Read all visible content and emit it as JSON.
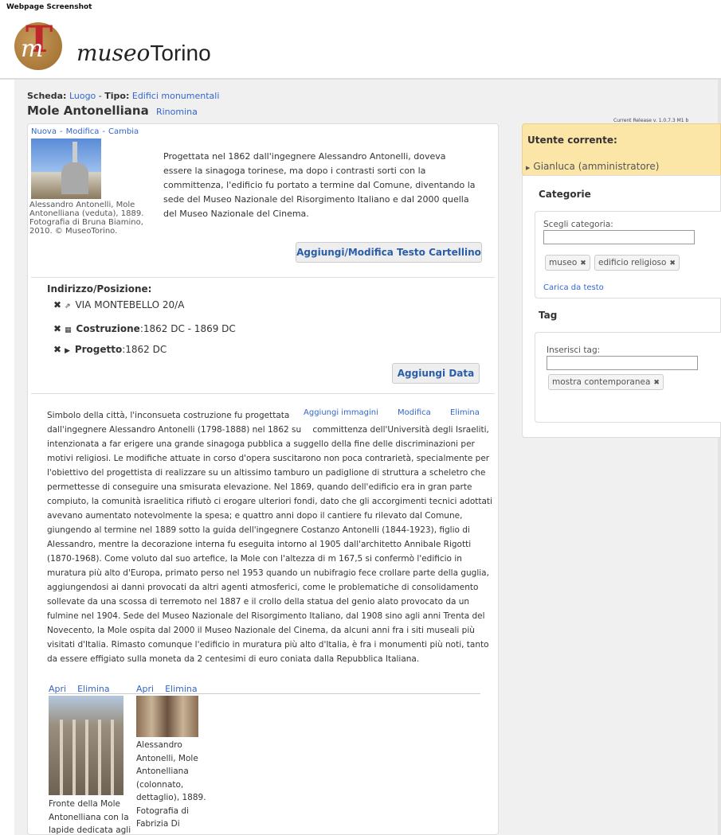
{
  "screenshot_label": "Webpage Screenshot",
  "header": {
    "logo_italic": "museo",
    "logo_upright": "Torino"
  },
  "breadcrumb": {
    "scheda_label": "Scheda:",
    "scheda_value": "Luogo",
    "tipo_label": "Tipo:",
    "tipo_value": "Edifici monumentali"
  },
  "title": {
    "name": "Mole Antonelliana",
    "rename_label": "Rinomina"
  },
  "release": "Current Release v. 1.0.7.3 M1 b",
  "card_links": {
    "nuova": "Nuova",
    "modifica": "Modifica",
    "cambia": "Cambia"
  },
  "main_image_caption": "Alessandro Antonelli, Mole Antonelliana (veduta), 1889. Fotografia di Bruna Biamino, 2010. © MuseoTorino.",
  "intro_text": "Progettata nel 1862 dall'ingegnere Alessandro Antonelli, doveva essere la sinagoga torinese, ma dopo i contrasti sorti con la committenza, l'edificio fu portato a termine dal Comune, diventando la sede del Museo Nazionale del Risorgimento Italiano e dal 2000 quella del Museo Nazionale del Cinema.",
  "buttons": {
    "cartellino": "Aggiungi/Modifica Testo Cartellino",
    "add_date": "Aggiungi Data"
  },
  "address": {
    "title": "Indirizzo/Posizione:",
    "street": "VIA MONTEBELLO 20/A",
    "costruzione_label": "Costruzione",
    "costruzione_value": ":1862 DC - 1869 DC",
    "progetto_label": "Progetto",
    "progetto_value": ":1862 DC"
  },
  "desc_actions": {
    "add_images": "Aggiungi immagini",
    "modifica": "Modifica",
    "elimina": "Elimina"
  },
  "description": {
    "lead": "Simbolo della città, l'inconsueta costruzione fu progettata dall'ingegnere Alessandro Antonelli (1798-1888) nel 1862 su",
    "body": "committenza dell'Università degli Israeliti, intenzionata a far erigere una grande sinagoga pubblica a suggello della fine delle discriminazioni per motivi religiosi. Le modifiche attuate in corso d'opera suscitarono non poca contrarietà, specialmente per l'obiettivo del progettista di realizzare su un altissimo tamburo un padiglione di struttura a scheletro che permettesse di conseguire una smisurata elevazione. Nel 1869, quando dell'edificio era in gran parte compiuto, la comunità israelitica rifiutò ci erogare ulteriori fondi, dato che gli accorgimenti tecnici adottati avevano aumentato notevolmente la spesa; e quattro anni dopo il cantiere fu rilevato dal Comune, giungendo al termine nel 1889 sotto la guida dell'ingegnere Costanzo Antonelli (1844-1923), figlio di Alessandro, mentre la decorazione interna fu eseguita intorno al 1905 dall'architetto Annibale Rigotti (1870-1968). Come voluto dal suo artefice, la Mole con l'altezza di m 167,5 si confermò l'edificio in muratura più alto d'Europa, primato perso nel 1953 quando un nubifragio fece crollare parte della guglia, aggiungendosi ai danni provocati da altri agenti atmosferici, come le problematiche di consolidamento sollevate da una scossa di terremoto nel 1887 e il crollo della statua del genio alato provocato da un fulmine nel 1904. Sede del Museo Nazionale del Risorgimento Italiano, dal 1908 sino agli anni Trenta del Novecento, la Mole ospita dal 2000 il Museo Nazionale del Cinema, da alcuni anni fra i siti museali più visitati d'Italia. Rimasto comunque l'edificio in muratura più alto d'Italia, è fra i monumenti più noti, tanto da essere effigiato sulla moneta da 2 centesimi di euro coniata dalla Repubblica Italiana."
  },
  "image_links": {
    "apri": "Apri",
    "elimina": "Elimina"
  },
  "image_captions": {
    "first": "Fronte della Mole Antonelliana con la lapide dedicata agli",
    "second": "Alessandro Antonelli, Mole Antonelliana (colonnato, dettaglio), 1889. Fotografia di Fabrizia Di"
  },
  "sidebar": {
    "user_title": "Utente corrente:",
    "user_name": "Gianluca (amministratore)",
    "categorie_title": "Categorie",
    "scegli_label": "Scegli categoria:",
    "chips": [
      "museo",
      "edificio religioso"
    ],
    "carica_label": "Carica da testo",
    "tag_title": "Tag",
    "inserisci_label": "Inserisci tag:",
    "tag_chip": "mostra contemporanea"
  }
}
